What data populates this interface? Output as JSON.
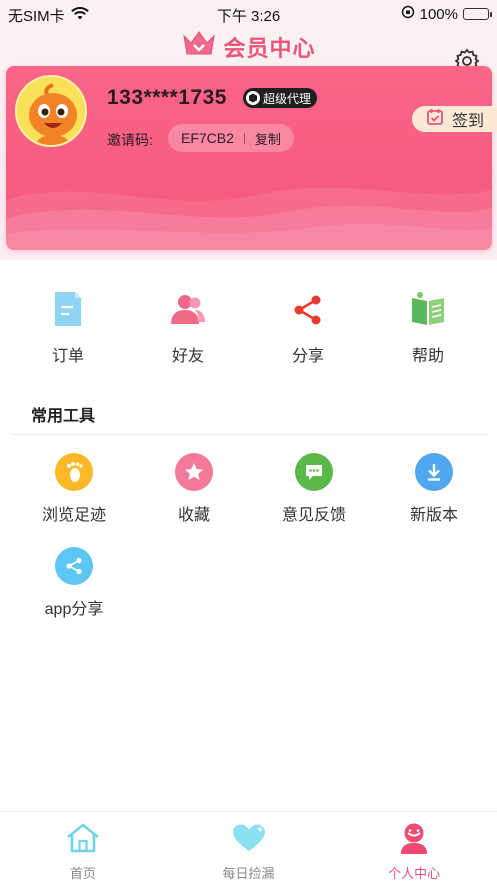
{
  "status_bar": {
    "carrier": "无SIM卡",
    "time": "下午 3:26",
    "battery": "100%",
    "icons": [
      "wifi-icon",
      "orientation-lock-icon",
      "battery-icon"
    ]
  },
  "header": {
    "title": "会员中心",
    "icons": [
      "crown-icon",
      "gear-icon"
    ]
  },
  "profile": {
    "phone": "133****1735",
    "badge": "超级代理",
    "invite_label": "邀请码:",
    "invite_code": "EF7CB2",
    "copy_label": "复制",
    "checkin_label": "签到"
  },
  "quick_menu": [
    {
      "label": "订单",
      "icon": "order-document-icon"
    },
    {
      "label": "好友",
      "icon": "friends-icon"
    },
    {
      "label": "分享",
      "icon": "share-icon"
    },
    {
      "label": "帮助",
      "icon": "help-book-icon"
    }
  ],
  "tools": {
    "title": "常用工具",
    "items": [
      {
        "label": "浏览足迹",
        "icon": "footprint-icon"
      },
      {
        "label": "收藏",
        "icon": "star-icon"
      },
      {
        "label": "意见反馈",
        "icon": "feedback-chat-icon"
      },
      {
        "label": "新版本",
        "icon": "download-icon"
      },
      {
        "label": "app分享",
        "icon": "app-share-icon"
      }
    ]
  },
  "bottom_nav": [
    {
      "label": "首页",
      "icon": "home-icon",
      "active": false
    },
    {
      "label": "每日捡漏",
      "icon": "heart-icon",
      "active": false
    },
    {
      "label": "个人中心",
      "icon": "person-icon",
      "active": true
    }
  ],
  "colors": {
    "accent": "#e8527a",
    "card": "#f65c81",
    "checkin_bg": "#fde9d6"
  }
}
